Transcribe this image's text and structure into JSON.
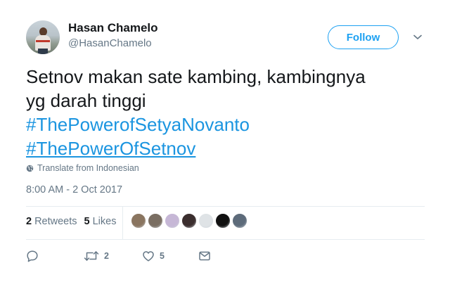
{
  "user": {
    "display_name": "Hasan Chamelo",
    "handle": "@HasanChamelo",
    "avatar_icon": "profile-photo"
  },
  "header": {
    "follow_label": "Follow",
    "menu_icon": "chevron-down-icon"
  },
  "tweet": {
    "text_lines": [
      "Setnov makan sate kambing,  kambingnya",
      "yg darah tinggi"
    ],
    "hashtags": [
      "#ThePowerofSetyaNovanto",
      "#ThePowerOfSetnov"
    ],
    "translate_label": "Translate from Indonesian",
    "timestamp": "8:00 AM - 2 Oct 2017"
  },
  "stats": {
    "retweets_count": "2",
    "retweets_label": "Retweets",
    "likes_count": "5",
    "likes_label": "Likes",
    "likers": [
      "#8a7560",
      "#7a6e62",
      "#c6b7d6",
      "#3b2e2e",
      "#dfe3e6",
      "#111111",
      "#5d6b7a"
    ]
  },
  "actions": {
    "reply_icon": "reply-icon",
    "retweet_icon": "retweet-icon",
    "retweet_count": "2",
    "like_icon": "heart-icon",
    "like_count": "5",
    "dm_icon": "envelope-icon"
  },
  "colors": {
    "link": "#1b95e0",
    "follow": "#1da1f2",
    "secondary_text": "#657786",
    "divider": "#e6ecf0"
  }
}
